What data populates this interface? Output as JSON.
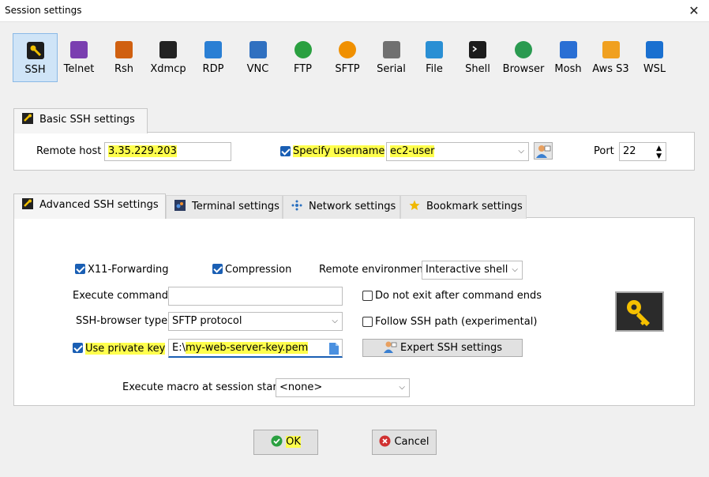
{
  "window": {
    "title": "Session settings",
    "close_glyph": "✕"
  },
  "toolbar": {
    "items": [
      {
        "label": "SSH",
        "icon": "ssh-key-icon",
        "color": "#f0c000",
        "selected": true
      },
      {
        "label": "Telnet",
        "icon": "telnet-icon",
        "color": "#7a3fb0"
      },
      {
        "label": "Rsh",
        "icon": "rsh-icon",
        "color": "#d06010"
      },
      {
        "label": "Xdmcp",
        "icon": "xdmcp-icon",
        "color": "#222222"
      },
      {
        "label": "RDP",
        "icon": "rdp-icon",
        "color": "#2a7fd4"
      },
      {
        "label": "VNC",
        "icon": "vnc-icon",
        "color": "#3070c0"
      },
      {
        "label": "FTP",
        "icon": "ftp-icon",
        "color": "#2aa040"
      },
      {
        "label": "SFTP",
        "icon": "sftp-icon",
        "color": "#f09000"
      },
      {
        "label": "Serial",
        "icon": "serial-icon",
        "color": "#707070"
      },
      {
        "label": "File",
        "icon": "file-icon",
        "color": "#2a8fd4"
      },
      {
        "label": "Shell",
        "icon": "shell-icon",
        "color": "#111111"
      },
      {
        "label": "Browser",
        "icon": "browser-icon",
        "color": "#2a9a50"
      },
      {
        "label": "Mosh",
        "icon": "mosh-icon",
        "color": "#2a6fd4"
      },
      {
        "label": "Aws S3",
        "icon": "aws-s3-icon",
        "color": "#f0a020"
      },
      {
        "label": "WSL",
        "icon": "wsl-icon",
        "color": "#1a70d0"
      }
    ]
  },
  "basic": {
    "tab_label": "Basic SSH settings",
    "remote_host_label": "Remote host *",
    "remote_host_value": "3.35.229.203",
    "specify_username_label": "Specify username",
    "specify_username_checked": true,
    "username_value": "ec2-user",
    "port_label": "Port",
    "port_value": "22"
  },
  "tabs": [
    {
      "label": "Advanced SSH settings",
      "icon": "wrench-icon",
      "active": true
    },
    {
      "label": "Terminal settings",
      "icon": "terminal-icon"
    },
    {
      "label": "Network settings",
      "icon": "network-icon"
    },
    {
      "label": "Bookmark settings",
      "icon": "star-icon"
    }
  ],
  "advanced": {
    "x11_label": "X11-Forwarding",
    "x11_checked": true,
    "compression_label": "Compression",
    "compression_checked": true,
    "remote_env_label": "Remote environment:",
    "remote_env_value": "Interactive shell",
    "exec_command_label": "Execute command:",
    "exec_command_value": "",
    "no_exit_label": "Do not exit after command ends",
    "no_exit_checked": false,
    "browser_type_label": "SSH-browser type:",
    "browser_type_value": "SFTP protocol",
    "follow_path_label": "Follow SSH path (experimental)",
    "follow_path_checked": false,
    "private_key_label": "Use private key",
    "private_key_checked": true,
    "private_key_drive": "E:\\",
    "private_key_file": "my-web-server-key.pem",
    "expert_button": "Expert SSH settings",
    "macro_label": "Execute macro at session start:",
    "macro_value": "<none>"
  },
  "footer": {
    "ok_label": "OK",
    "cancel_label": "Cancel"
  },
  "colors": {
    "highlight": "#ffff4d",
    "checkbox": "#1a5fb4",
    "ok": "#2aa040",
    "cancel": "#d03030"
  }
}
